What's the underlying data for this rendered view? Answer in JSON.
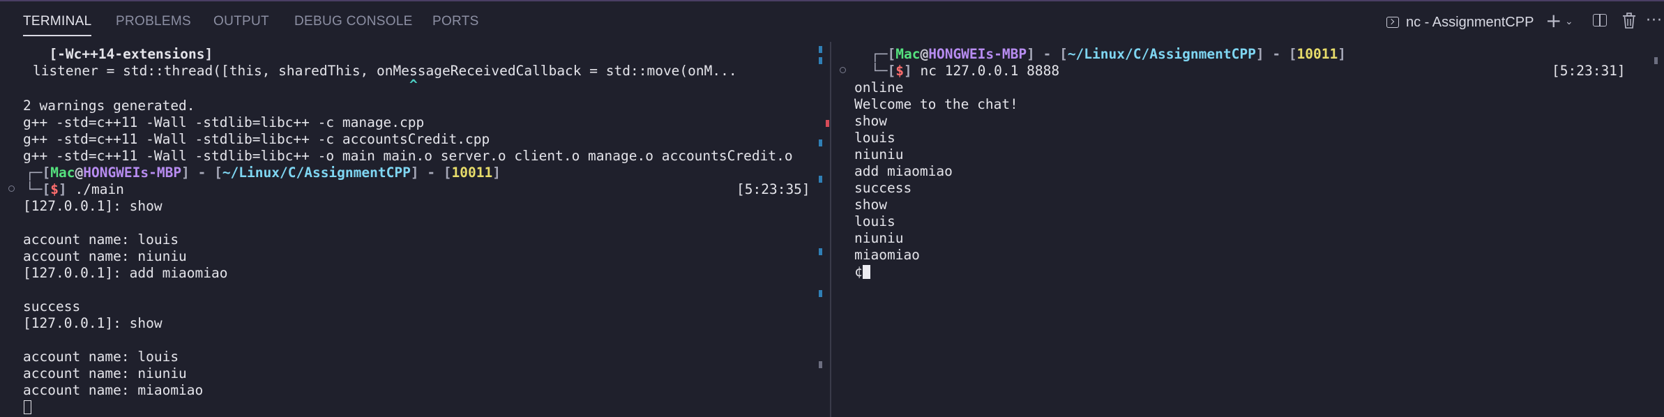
{
  "tabs": [
    {
      "label": "TERMINAL",
      "active": true
    },
    {
      "label": "PROBLEMS",
      "active": false
    },
    {
      "label": "OUTPUT",
      "active": false
    },
    {
      "label": "DEBUG CONSOLE",
      "active": false
    },
    {
      "label": "PORTS",
      "active": false
    }
  ],
  "terminal_title": "nc - AssignmentCPP",
  "toolbar_icons": [
    "terminal-icon",
    "plus-icon",
    "chevron-down-icon",
    "split-icon",
    "trash-icon",
    "more-icon"
  ],
  "colors": {
    "background": "#1f202c",
    "user": "#55e27e",
    "host": "#b78cf0",
    "path": "#7fd6f2",
    "number": "#e7dc6a",
    "dollar": "#ff6d6d"
  },
  "left_pane": {
    "build_lines": [
      "      [-Wc++14-extensions]",
      "    listener = std::thread([this, sharedThis, onMessageReceivedCallback = std::move(onM...",
      "                                                  ^",
      "",
      "2 warnings generated.",
      "g++ -std=c++11 -Wall -stdlib=libc++ -c manage.cpp",
      "g++ -std=c++11 -Wall -stdlib=libc++ -c accountsCredit.cpp",
      "g++ -std=c++11 -Wall -stdlib=libc++ -o main main.o server.o client.o manage.o accountsCredit.o"
    ],
    "prompt": {
      "user": "Mac",
      "at": "@",
      "host": "HONGWEIs-MBP",
      "path": "~/Linux/C/AssignmentCPP",
      "number": "10011",
      "dollar": "$",
      "command": "./main",
      "time": "[5:23:35]"
    },
    "output_lines": [
      "[127.0.0.1]: show",
      "",
      "account name: louis",
      "account name: niuniu",
      "[127.0.0.1]: add miaomiao",
      "",
      "success",
      "[127.0.0.1]: show",
      "",
      "account name: louis",
      "account name: niuniu",
      "account name: miaomiao"
    ]
  },
  "right_pane": {
    "prompt": {
      "user": "Mac",
      "at": "@",
      "host": "HONGWEIs-MBP",
      "path": "~/Linux/C/AssignmentCPP",
      "number": "10011",
      "dollar": "$",
      "command": "nc 127.0.0.1 8888",
      "time": "[5:23:31]"
    },
    "output_lines": [
      "online",
      "Welcome to the chat!",
      "show",
      "louis",
      "niuniu",
      "add miaomiao",
      "success",
      "show",
      "louis",
      "niuniu",
      "miaomiao"
    ],
    "input_prefix": "¢"
  }
}
